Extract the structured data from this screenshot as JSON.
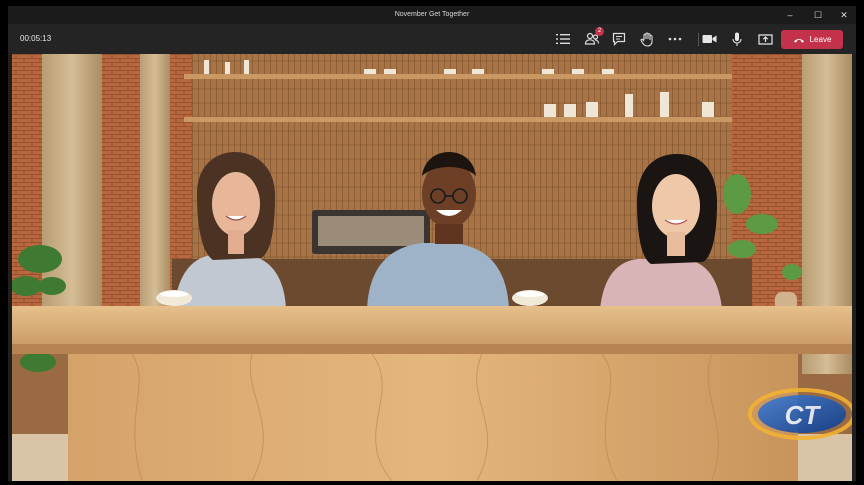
{
  "window": {
    "title": "November Get Together",
    "controls": {
      "minimize": "–",
      "maximize": "☐",
      "close": "✕"
    }
  },
  "toolbar": {
    "timer": "00:05:13",
    "participants_badge": "2",
    "leave_label": "Leave",
    "icons": [
      "list-icon",
      "participants-icon",
      "chat-icon",
      "raise-hand-icon",
      "more-icon",
      "camera-icon",
      "microphone-icon",
      "share-icon",
      "phone-hangup-icon"
    ]
  },
  "scene": {
    "mode": "together-mode",
    "participants": [
      "participant-woman-left",
      "participant-man-center",
      "participant-woman-right"
    ],
    "watermark_text": "CT"
  },
  "colors": {
    "toolbar_bg": "#242424",
    "leave_button": "#c4314b",
    "badge": "#c4314b",
    "brick": "#b5653d",
    "desk": "#d9a870"
  }
}
